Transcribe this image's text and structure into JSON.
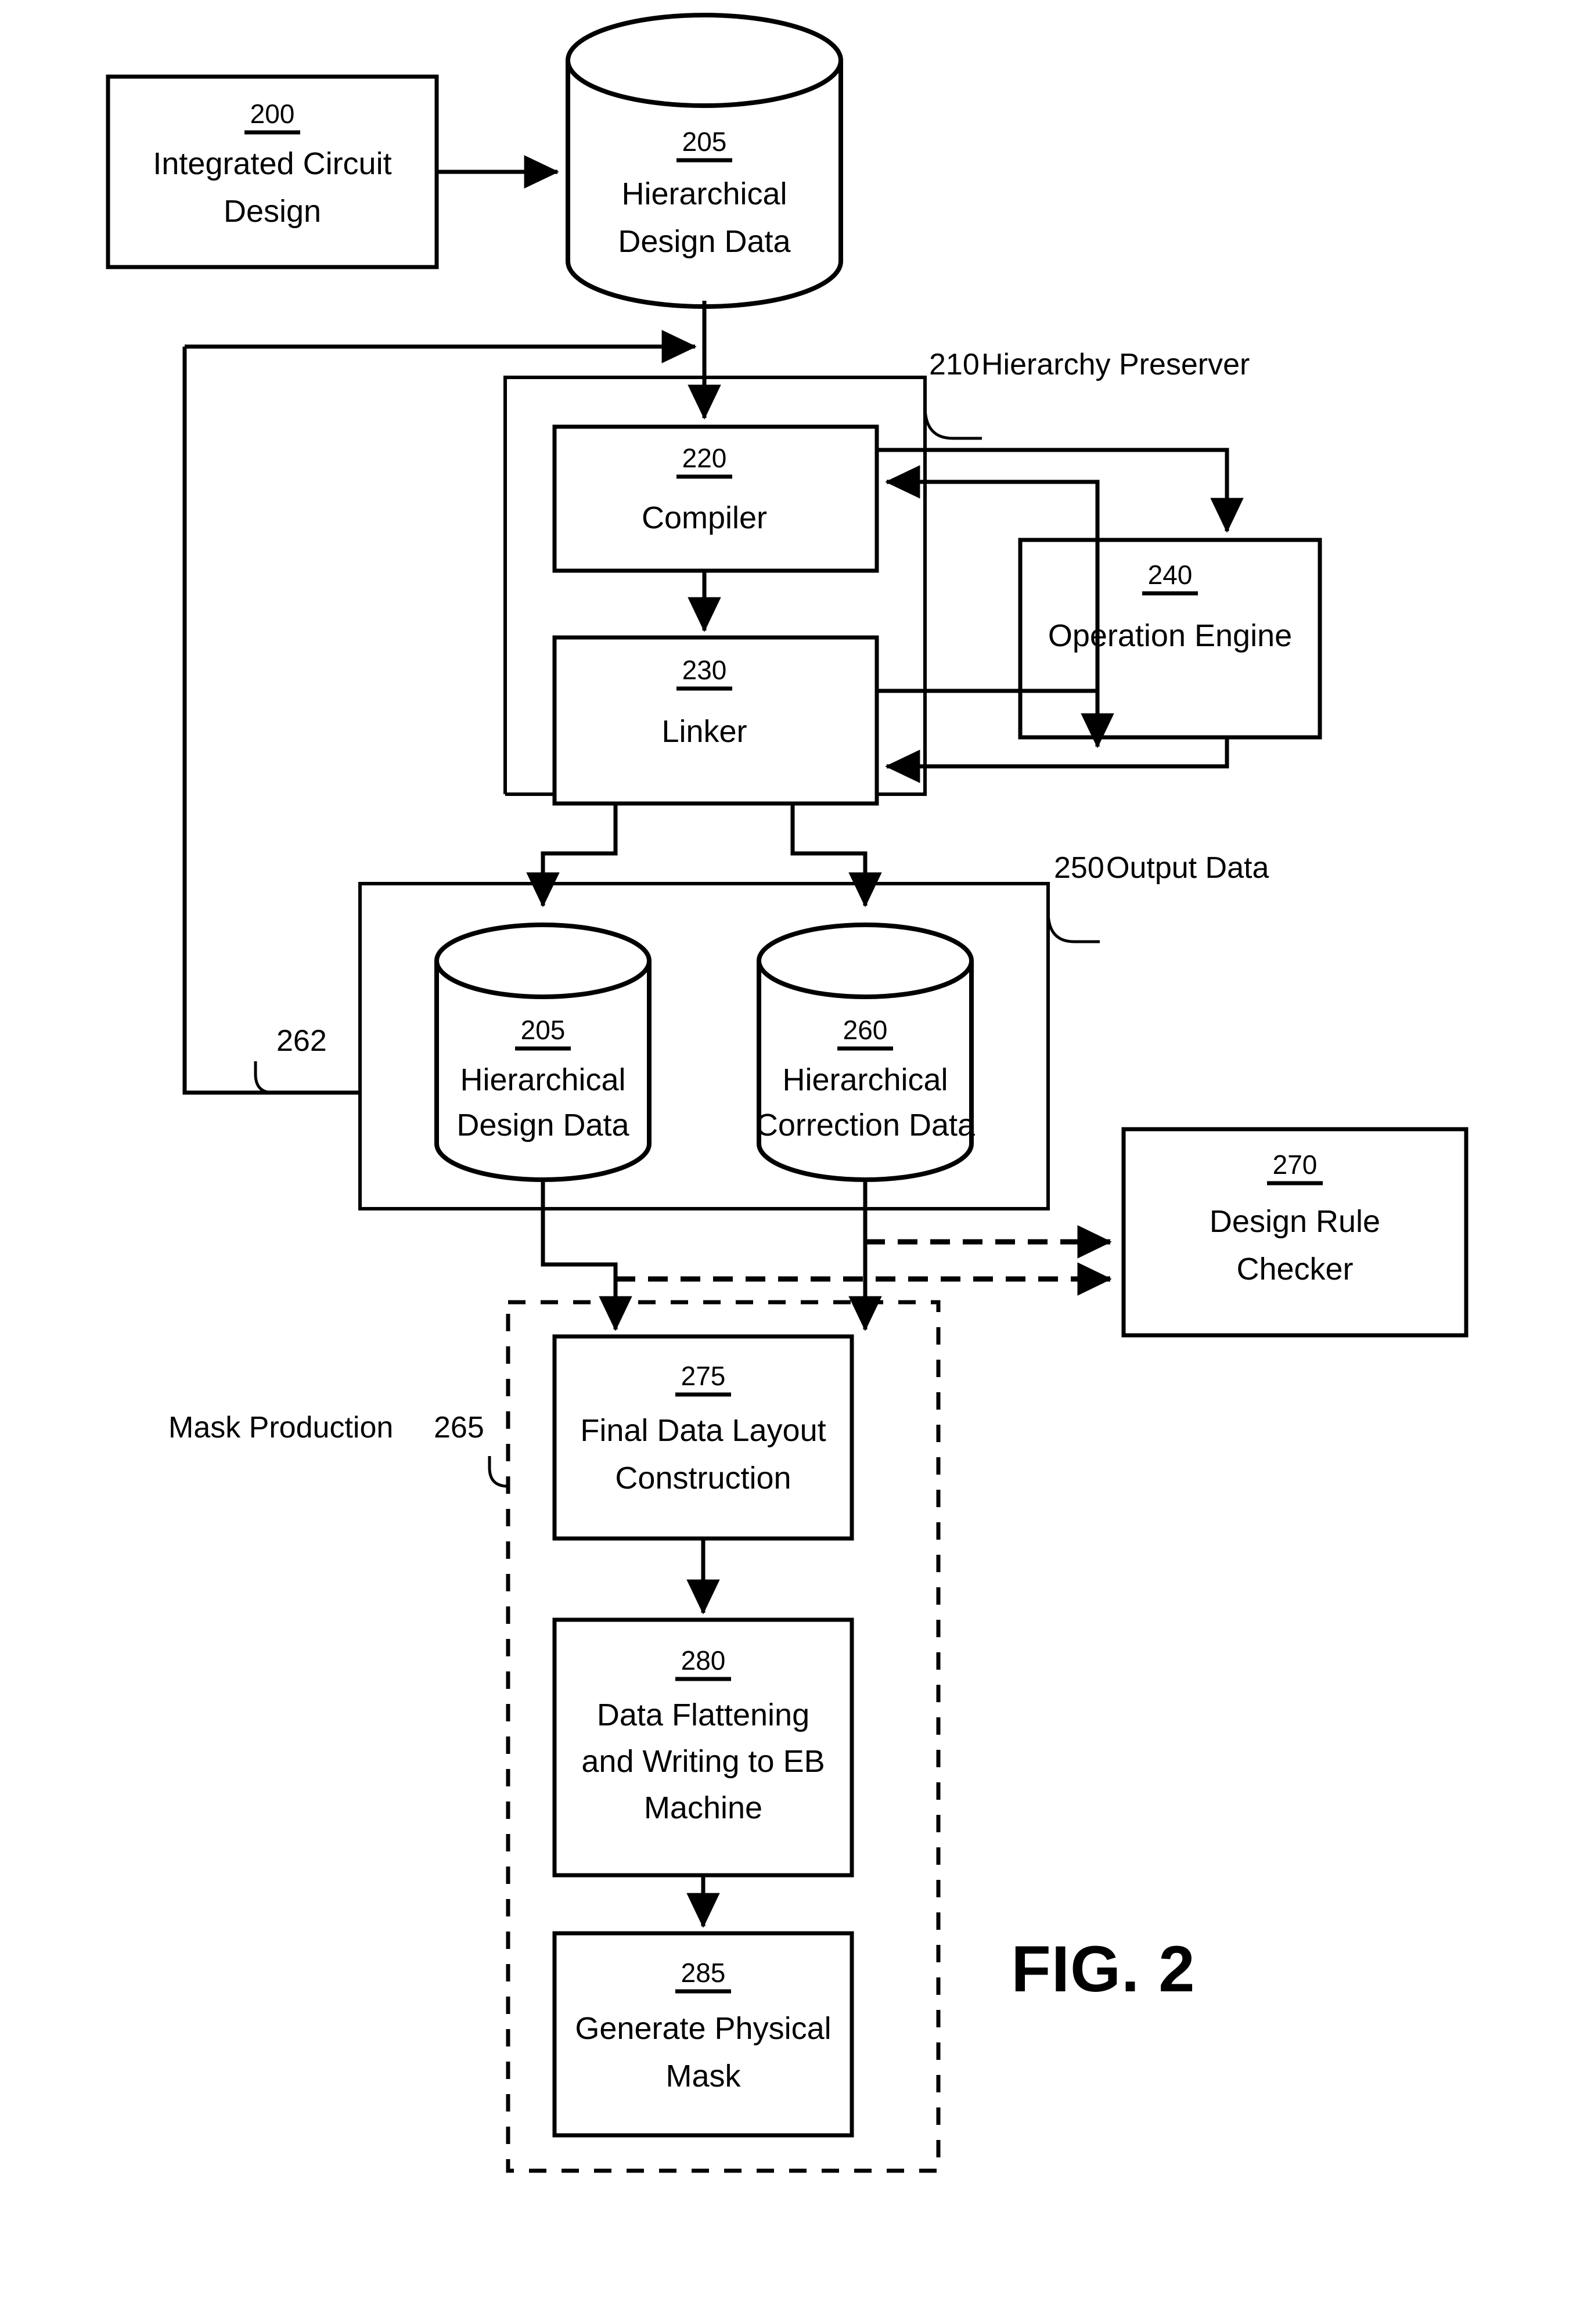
{
  "figure": {
    "caption": "FIG. 2"
  },
  "nodes": {
    "ic_design": {
      "number": "200",
      "lines": [
        "Integrated Circuit",
        "Design"
      ]
    },
    "hier_design_data_top": {
      "number": "205",
      "lines": [
        "Hierarchical",
        "Design Data"
      ]
    },
    "hierarchy_preserver": {
      "number": "210",
      "label": "Hierarchy Preserver"
    },
    "compiler": {
      "number": "220",
      "lines": [
        "Compiler"
      ]
    },
    "linker": {
      "number": "230",
      "lines": [
        "Linker"
      ]
    },
    "operation_engine": {
      "number": "240",
      "lines": [
        "Operation Engine"
      ]
    },
    "output_data": {
      "number": "250",
      "label": "Output Data"
    },
    "hier_design_data_out": {
      "number": "205",
      "lines": [
        "Hierarchical",
        "Design Data"
      ]
    },
    "hier_correction_data": {
      "number": "260",
      "lines": [
        "Hierarchical",
        "Correction Data"
      ]
    },
    "feedback_path": {
      "number": "262"
    },
    "mask_production": {
      "number": "265",
      "label": "Mask Production"
    },
    "design_rule_checker": {
      "number": "270",
      "lines": [
        "Design Rule",
        "Checker"
      ]
    },
    "final_layout": {
      "number": "275",
      "lines": [
        "Final Data Layout",
        "Construction"
      ]
    },
    "data_flattening": {
      "number": "280",
      "lines": [
        "Data Flattening",
        "and Writing to EB",
        "Machine"
      ]
    },
    "generate_mask": {
      "number": "285",
      "lines": [
        "Generate Physical",
        "Mask"
      ]
    }
  },
  "colors": {
    "stroke": "#000000",
    "fill": "#ffffff"
  }
}
